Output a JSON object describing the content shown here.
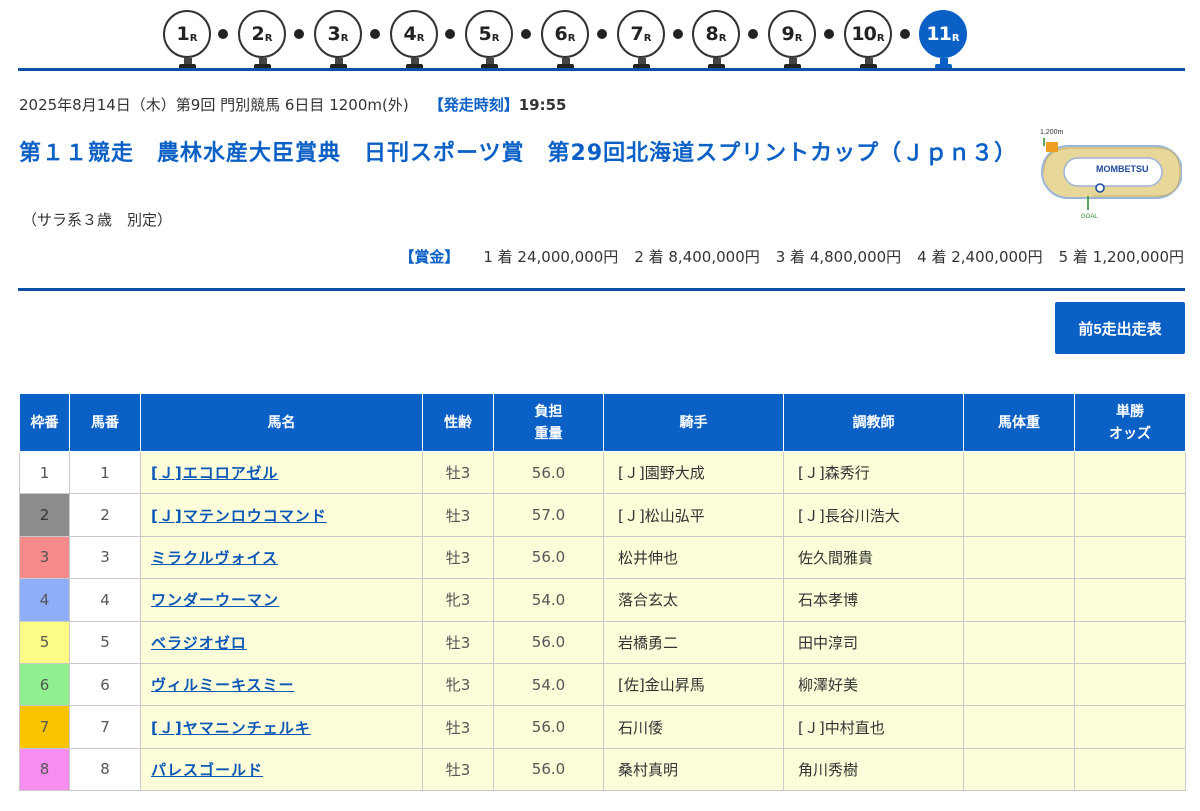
{
  "race_nav": {
    "races": [
      {
        "num": "1",
        "suffix": "R"
      },
      {
        "num": "2",
        "suffix": "R"
      },
      {
        "num": "3",
        "suffix": "R"
      },
      {
        "num": "4",
        "suffix": "R"
      },
      {
        "num": "5",
        "suffix": "R"
      },
      {
        "num": "6",
        "suffix": "R"
      },
      {
        "num": "7",
        "suffix": "R"
      },
      {
        "num": "8",
        "suffix": "R"
      },
      {
        "num": "9",
        "suffix": "R"
      },
      {
        "num": "10",
        "suffix": "R"
      },
      {
        "num": "11",
        "suffix": "R"
      }
    ],
    "active_race": "11"
  },
  "race_info": {
    "meta": "2025年8月14日（木）第9回 門別競馬 6日目 1200m(外)",
    "post_time_label": "【発走時刻】",
    "post_time": "19:55",
    "title": "第１１競走　農林水産大臣賞典　日刊スポーツ賞　第29回北海道スプリントカップ（Ｊｐｎ３）",
    "conditions": "（サラ系３歳　別定）",
    "course_map": {
      "distance_label": "1,200m",
      "track_label": "MOMBETSU",
      "goal_label": "GOAL"
    }
  },
  "prize": {
    "label": "【賞金】",
    "items": [
      "1 着 24,000,000円",
      "2 着 8,400,000円",
      "3 着 4,800,000円",
      "4 着 2,400,000円",
      "5 着 1,200,000円"
    ]
  },
  "buttons": {
    "past_runs": "前5走出走表"
  },
  "table": {
    "headers": {
      "waku": "枠番",
      "umaban": "馬番",
      "name": "馬名",
      "sex_age": "性齢",
      "weight_line1": "負担",
      "weight_line2": "重量",
      "jockey": "騎手",
      "trainer": "調教師",
      "body_weight": "馬体重",
      "odds_line1": "単勝",
      "odds_line2": "オッズ"
    },
    "rows": [
      {
        "waku": "1",
        "umaban": "1",
        "name": "[Ｊ]エコロアゼル",
        "sex_age": "牡3",
        "weight": "56.0",
        "jockey": "[Ｊ]園野大成",
        "trainer": "[Ｊ]森秀行",
        "body_weight": "",
        "odds": ""
      },
      {
        "waku": "2",
        "umaban": "2",
        "name": "[Ｊ]マテンロウコマンド",
        "sex_age": "牡3",
        "weight": "57.0",
        "jockey": "[Ｊ]松山弘平",
        "trainer": "[Ｊ]長谷川浩大",
        "body_weight": "",
        "odds": ""
      },
      {
        "waku": "3",
        "umaban": "3",
        "name": "ミラクルヴォイス",
        "sex_age": "牡3",
        "weight": "56.0",
        "jockey": "松井伸也",
        "trainer": "佐久間雅貴",
        "body_weight": "",
        "odds": ""
      },
      {
        "waku": "4",
        "umaban": "4",
        "name": "ワンダーウーマン",
        "sex_age": "牝3",
        "weight": "54.0",
        "jockey": "落合玄太",
        "trainer": "石本孝博",
        "body_weight": "",
        "odds": ""
      },
      {
        "waku": "5",
        "umaban": "5",
        "name": "ベラジオゼロ",
        "sex_age": "牡3",
        "weight": "56.0",
        "jockey": "岩橋勇二",
        "trainer": "田中淳司",
        "body_weight": "",
        "odds": ""
      },
      {
        "waku": "6",
        "umaban": "6",
        "name": "ヴィルミーキスミー",
        "sex_age": "牝3",
        "weight": "54.0",
        "jockey": "[佐]金山昇馬",
        "trainer": "柳澤好美",
        "body_weight": "",
        "odds": ""
      },
      {
        "waku": "7",
        "umaban": "7",
        "name": "[Ｊ]ヤマニンチェルキ",
        "sex_age": "牡3",
        "weight": "56.0",
        "jockey": "石川倭",
        "trainer": "[Ｊ]中村直也",
        "body_weight": "",
        "odds": ""
      },
      {
        "waku": "8",
        "umaban": "8",
        "name": "パレスゴールド",
        "sex_age": "牡3",
        "weight": "56.0",
        "jockey": "桑村真明",
        "trainer": "角川秀樹",
        "body_weight": "",
        "odds": ""
      }
    ]
  },
  "colors": {
    "accent": "#0b60c6",
    "waku": [
      "#ffffff",
      "#8c8c8c",
      "#f78a8a",
      "#8eaefa",
      "#fbfb86",
      "#8ef08e",
      "#fbc400",
      "#f88ef0"
    ]
  }
}
